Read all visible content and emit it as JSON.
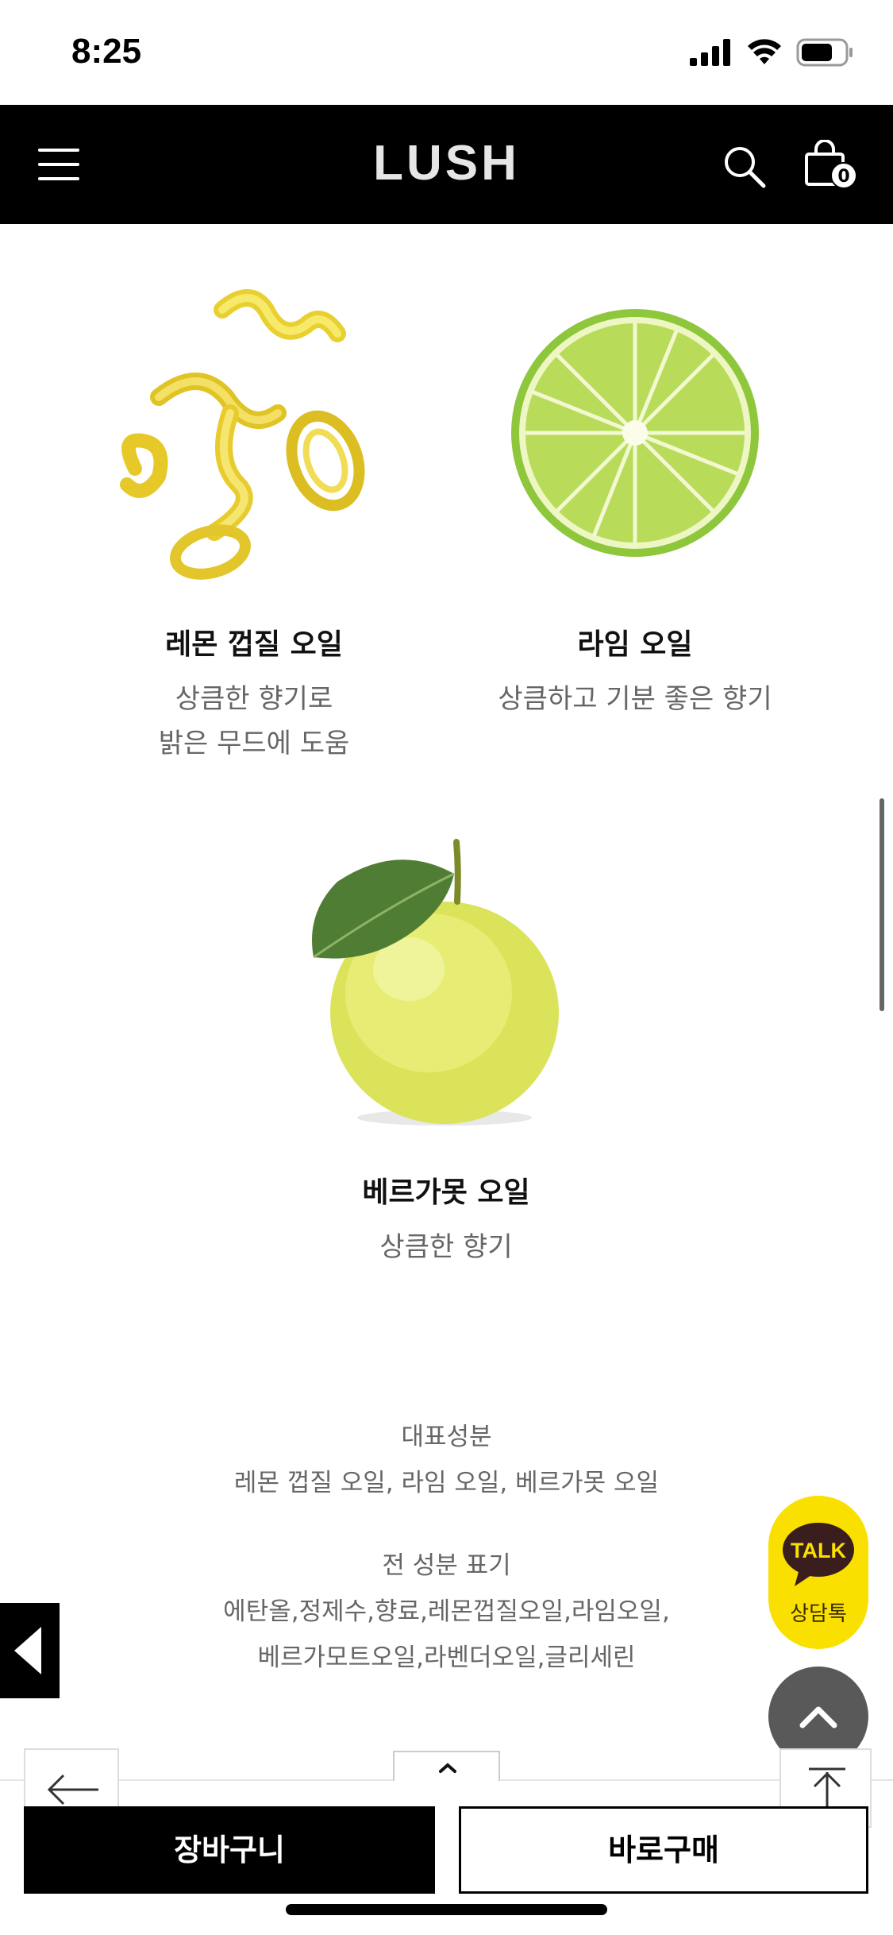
{
  "status_bar": {
    "time": "8:25"
  },
  "header": {
    "logo": "LUSH",
    "cart_count": "0"
  },
  "ingredients": [
    {
      "name": "레몬 껍질 오일",
      "desc_line1": "상큼한 향기로",
      "desc_line2": "밝은 무드에 도움"
    },
    {
      "name": "라임 오일",
      "desc_line1": "상큼하고 기분 좋은 향기"
    },
    {
      "name": "베르가못 오일",
      "desc_line1": "상큼한 향기"
    }
  ],
  "info": {
    "key_ingredients_title": "대표성분",
    "key_ingredients": "레몬 껍질 오일, 라임 오일, 베르가못 오일",
    "full_ingredients_title": "전 성분 표기",
    "full_ingredients_line1": "에탄올,정제수,향료,레몬껍질오일,라임오일,",
    "full_ingredients_line2": "베르가모트오일,라벤더오일,글리세린"
  },
  "floating": {
    "talk_badge": "TALK",
    "talk_label": "상담톡"
  },
  "bottom_bar": {
    "cart_label": "장바구니",
    "buy_label": "바로구매"
  },
  "colors": {
    "header_bg": "#000000",
    "talk_yellow": "#f9e000",
    "top_button": "#595959"
  }
}
